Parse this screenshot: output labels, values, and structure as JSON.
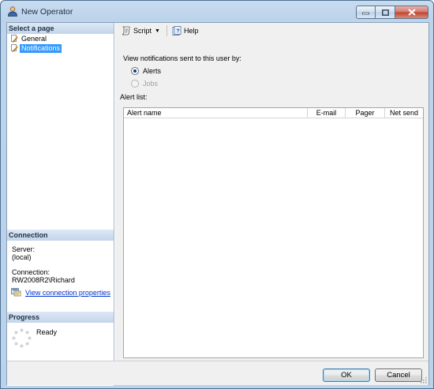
{
  "window": {
    "title": "New Operator",
    "controls": [
      "minimize",
      "maximize",
      "close"
    ]
  },
  "left": {
    "select_page_header": "Select a page",
    "pages": [
      {
        "label": "General",
        "icon": "page-wrench-icon",
        "selected": false
      },
      {
        "label": "Notifications",
        "icon": "page-wrench-icon",
        "selected": true
      }
    ],
    "connection": {
      "header": "Connection",
      "server_label": "Server:",
      "server_value": "(local)",
      "connection_label": "Connection:",
      "connection_value": "RW2008R2\\Richard",
      "link_text": "View connection properties"
    },
    "progress": {
      "header": "Progress",
      "status": "Ready"
    }
  },
  "toolbar": {
    "script_label": "Script",
    "help_label": "Help"
  },
  "notifications": {
    "intro": "View notifications sent to this user by:",
    "options": [
      {
        "label": "Alerts",
        "checked": true,
        "enabled": true
      },
      {
        "label": "Jobs",
        "checked": false,
        "enabled": false
      }
    ],
    "list_label": "Alert list:",
    "columns": [
      "Alert name",
      "E-mail",
      "Pager",
      "Net send"
    ],
    "rows": []
  },
  "buttons": {
    "ok": "OK",
    "cancel": "Cancel"
  },
  "colors": {
    "selection": "#3399ff",
    "link": "#0033cc",
    "section_header": "#c4d5ea"
  }
}
